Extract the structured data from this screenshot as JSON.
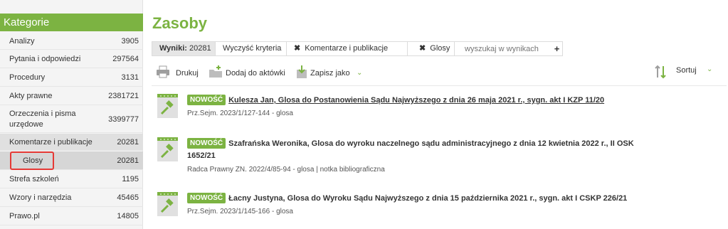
{
  "sidebar": {
    "header": "Kategorie",
    "items": [
      {
        "label": "Analizy",
        "count": "3905"
      },
      {
        "label": "Pytania i odpowiedzi",
        "count": "297564"
      },
      {
        "label": "Procedury",
        "count": "3131"
      },
      {
        "label": "Akty prawne",
        "count": "2381721"
      },
      {
        "label": "Orzeczenia i pisma",
        "label2": "urzędowe",
        "count": "3399777"
      },
      {
        "label": "Komentarze i publikacje",
        "count": "20281"
      },
      {
        "label": "Glosy",
        "count": "20281"
      },
      {
        "label": "Strefa szkoleń",
        "count": "1195"
      },
      {
        "label": "Wzory i narzędzia",
        "count": "45465"
      },
      {
        "label": "Prawo.pl",
        "count": "14805"
      }
    ]
  },
  "main": {
    "title": "Zasoby",
    "filter": {
      "results_label": "Wyniki:",
      "results_count": "20281",
      "clear": "Wyczyść kryteria",
      "chip1": "Komentarze i publikacje",
      "chip2": "Glosy",
      "search_placeholder": "wyszukaj w wynikach",
      "plus": "+",
      "x": "✖"
    },
    "toolbar": {
      "print": "Drukuj",
      "add": "Dodaj do aktówki",
      "save": "Zapisz jako",
      "sort": "Sortuj"
    },
    "results": [
      {
        "badge": "NOWOŚĆ",
        "title": "Kulesza Jan, Glosa do Postanowienia Sądu Najwyższego z dnia 26 maja 2021 r., sygn. akt I KZP 11/20",
        "meta": "Prz.Sejm. 2023/1/127-144 - glosa"
      },
      {
        "badge": "NOWOŚĆ",
        "title": "Szafrańska Weronika, Glosa do wyroku naczelnego sądu administracyjnego z dnia 12 kwietnia 2022 r., II OSK",
        "title2": "1652/21",
        "meta": "Radca Prawny ZN. 2022/4/85-94 - glosa  |  notka bibliograficzna"
      },
      {
        "badge": "NOWOŚĆ",
        "title": "Łacny Justyna, Glosa do Wyroku Sądu Najwyższego z dnia 15 października 2021 r., sygn. akt I CSKP 226/21",
        "meta": "Prz.Sejm. 2023/1/145-166 - glosa"
      }
    ]
  },
  "colors": {
    "accent": "#7cb342",
    "highlight": "#e53935"
  }
}
